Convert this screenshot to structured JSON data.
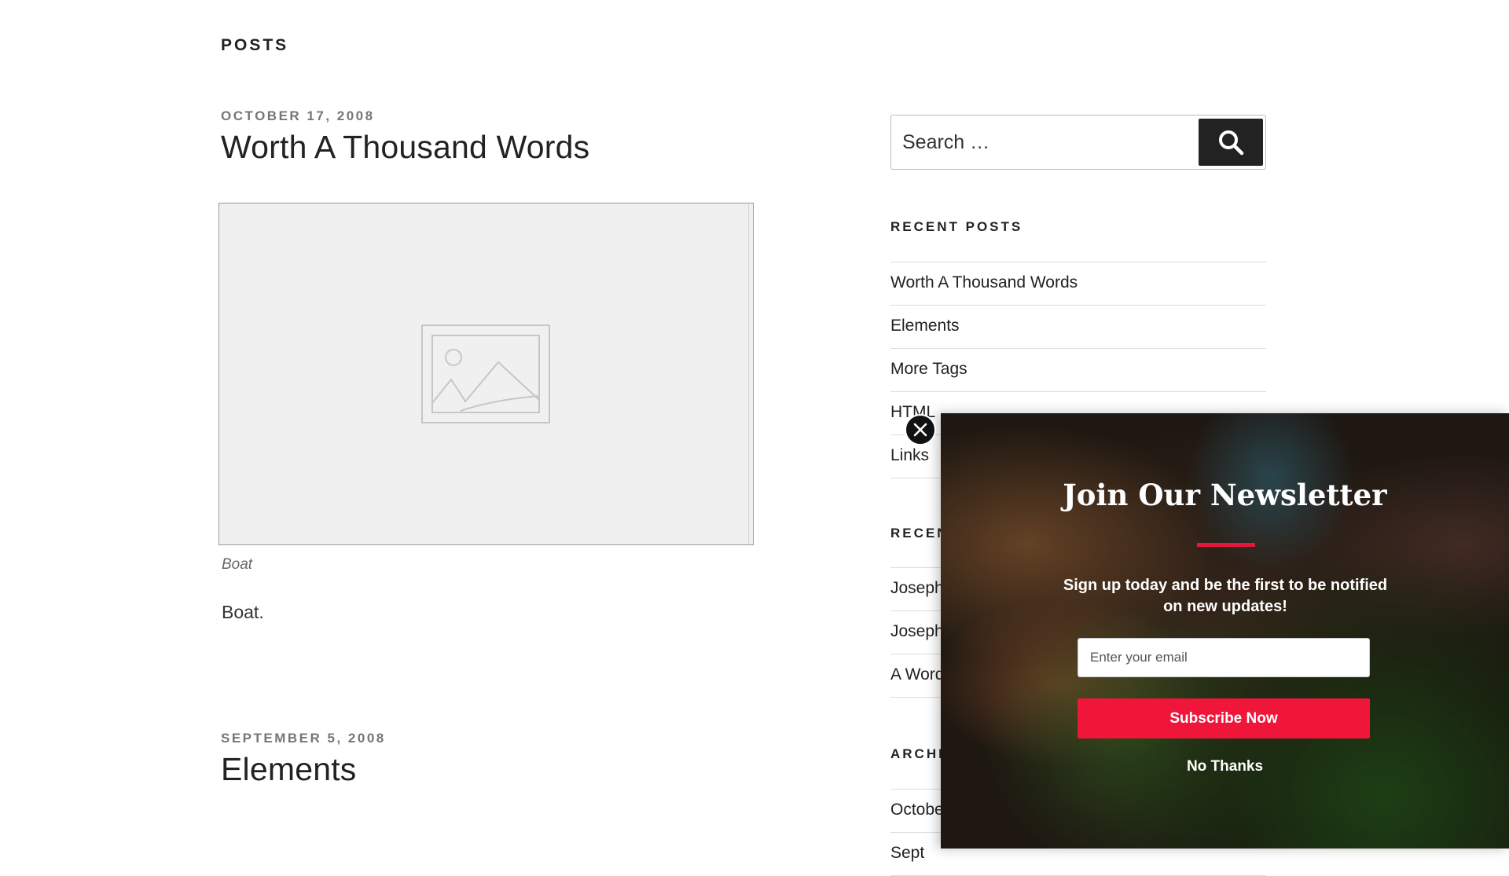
{
  "page": {
    "heading": "POSTS"
  },
  "posts": [
    {
      "date": "OCTOBER 17, 2008",
      "title": "Worth A Thousand Words",
      "caption": "Boat",
      "body": "Boat."
    },
    {
      "date": "SEPTEMBER 5, 2008",
      "title": "Elements"
    }
  ],
  "search": {
    "placeholder": "Search …",
    "icon": "search-icon"
  },
  "sidebar": {
    "recent_posts": {
      "title": "RECENT POSTS",
      "items": [
        "Worth A Thousand Words",
        "Elements",
        "More Tags",
        "HTML",
        "Links"
      ]
    },
    "recent_comments": {
      "title": "RECENT COMMENTS",
      "items": [
        "Joseph",
        "Joseph",
        "A Word"
      ]
    },
    "archives": {
      "title": "ARCHIVES",
      "items": [
        "October",
        "Sept"
      ]
    }
  },
  "popup": {
    "title": "Join Our Newsletter",
    "subtitle": "Sign up today and be the first to be notified on new updates!",
    "email_placeholder": "Enter your email",
    "subscribe_label": "Subscribe Now",
    "no_thanks_label": "No Thanks",
    "accent_color": "#f0163a",
    "close_icon": "close-icon"
  }
}
